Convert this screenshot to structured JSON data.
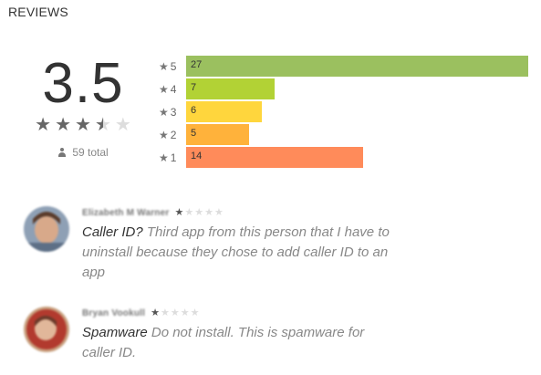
{
  "section": {
    "title": "REVIEWS"
  },
  "summary": {
    "score": "3.5",
    "stars": [
      "full",
      "full",
      "full",
      "half",
      "empty"
    ],
    "total_text": "59 total",
    "total_icon": "person-icon"
  },
  "histogram": {
    "rows": [
      {
        "stars": "5",
        "count": "27",
        "value": 27,
        "color": "#9bc05f"
      },
      {
        "stars": "4",
        "count": "7",
        "value": 7,
        "color": "#b2d235"
      },
      {
        "stars": "3",
        "count": "6",
        "value": 6,
        "color": "#ffd63d"
      },
      {
        "stars": "2",
        "count": "5",
        "value": 5,
        "color": "#ffb23b"
      },
      {
        "stars": "1",
        "count": "14",
        "value": 14,
        "color": "#ff8b5a"
      }
    ],
    "max_value": 27
  },
  "reviews": [
    {
      "author": "Elizabeth M Warner",
      "rating": 1,
      "headline": "Caller ID?",
      "body": " Third app from this person that I have to uninstall because they chose to add caller ID to an app"
    },
    {
      "author": "Bryan Vookull",
      "rating": 1,
      "headline": "Spamware",
      "body": " Do not install. This is spamware for caller ID."
    }
  ],
  "colors": {
    "star_full": "#666666",
    "star_empty": "#dddddd",
    "text_muted": "#888888"
  }
}
